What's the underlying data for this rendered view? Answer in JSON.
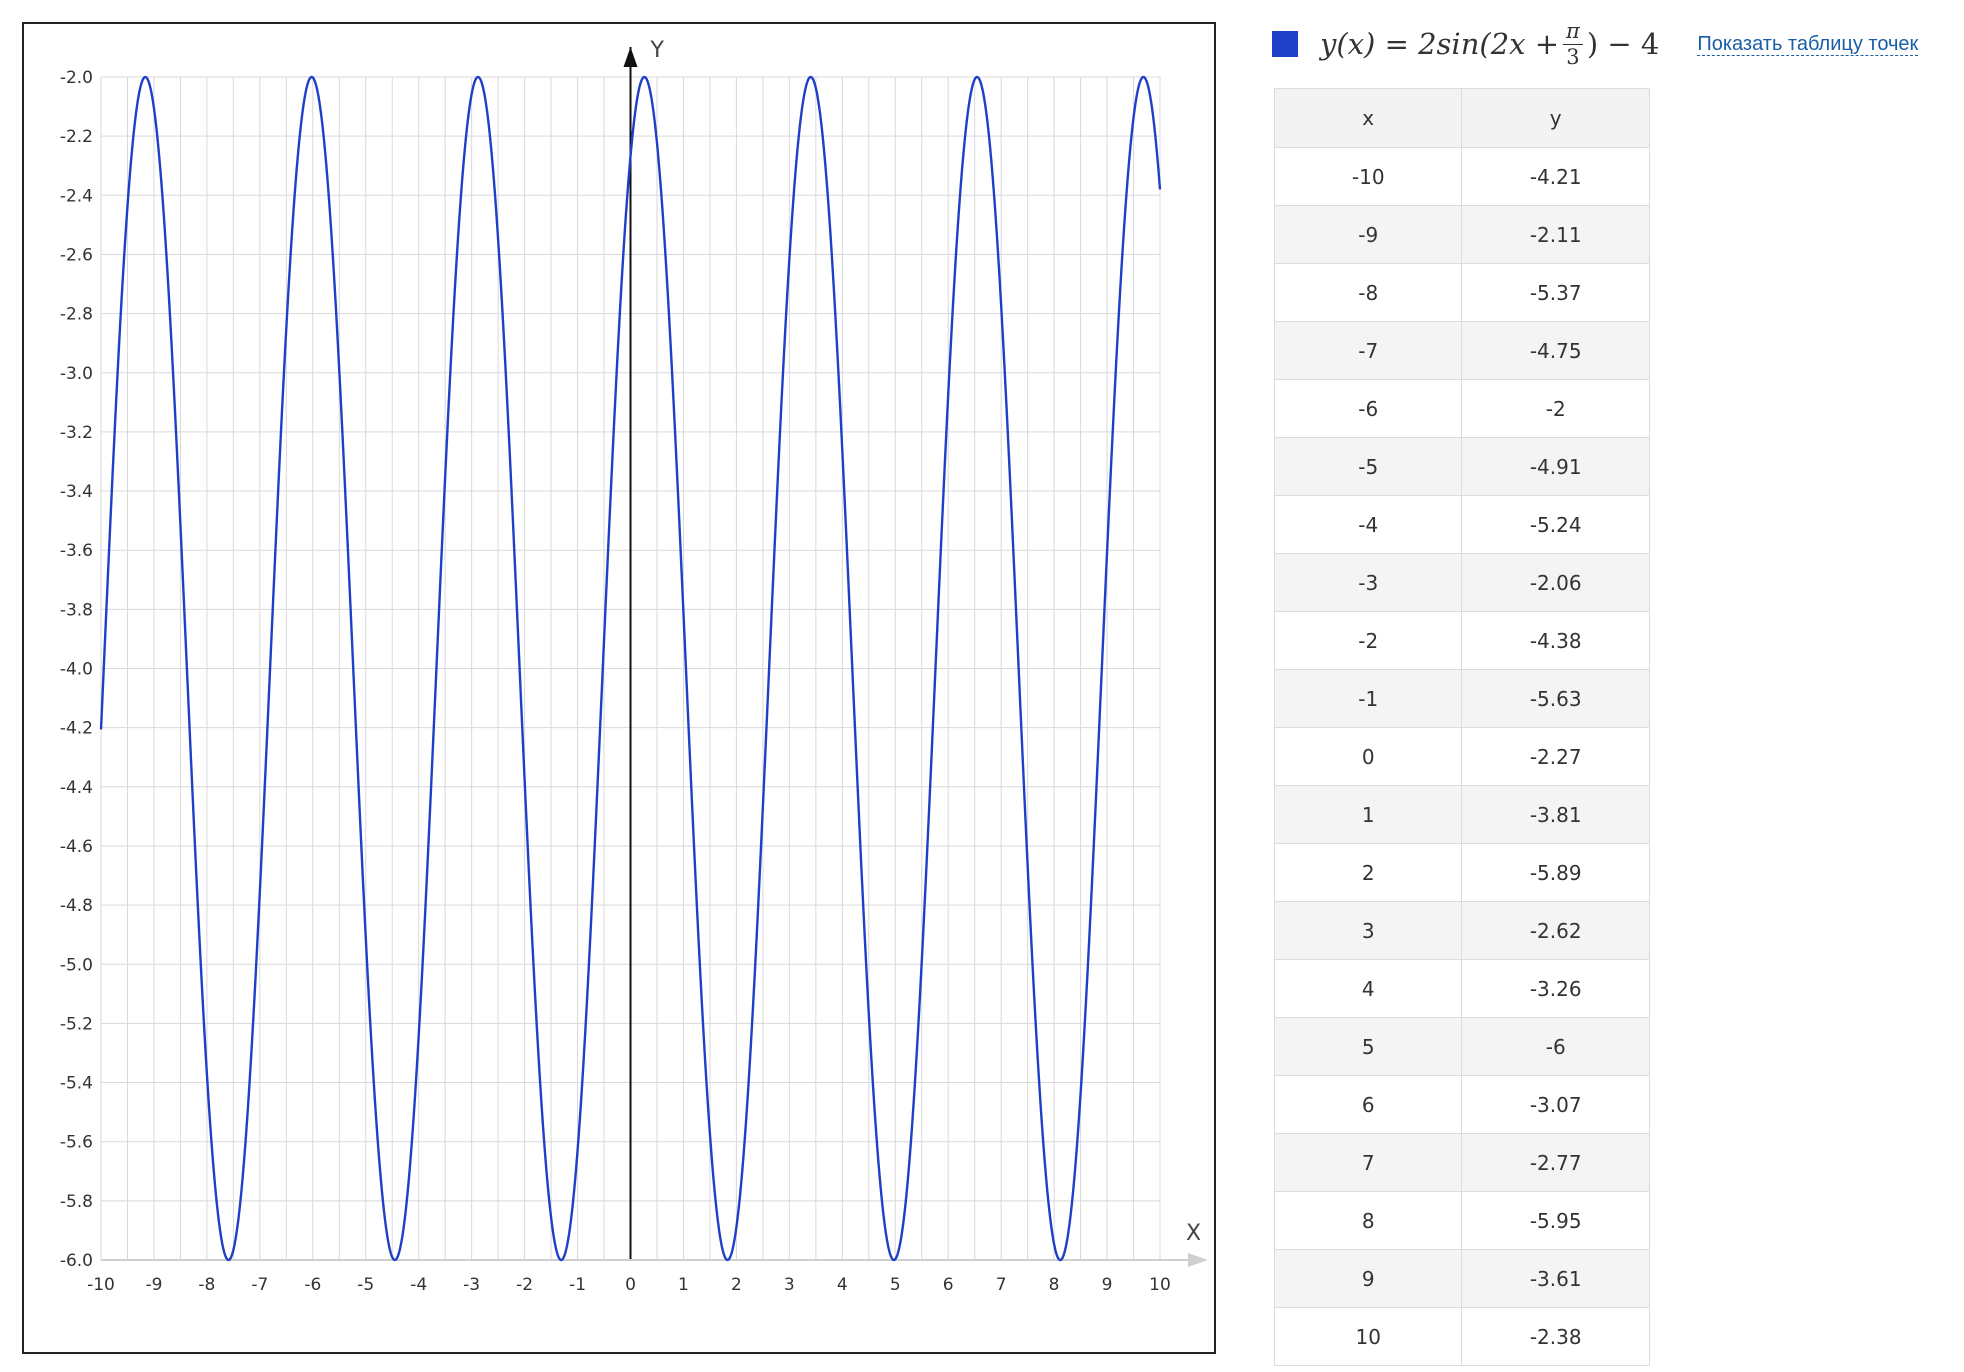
{
  "chart_data": {
    "type": "line",
    "xlabel": "X",
    "ylabel": "Y",
    "xlim": [
      -10,
      10
    ],
    "ylim": [
      -6.0,
      -2.0
    ],
    "grid": true,
    "x_ticks": [
      -10,
      -9,
      -8,
      -7,
      -6,
      -5,
      -4,
      -3,
      -2,
      -1,
      0,
      1,
      2,
      3,
      4,
      5,
      6,
      7,
      8,
      9,
      10
    ],
    "y_ticks": [
      "-2.0",
      "-2.2",
      "-2.4",
      "-2.6",
      "-2.8",
      "-3.0",
      "-3.2",
      "-3.4",
      "-3.6",
      "-3.8",
      "-4.0",
      "-4.2",
      "-4.4",
      "-4.6",
      "-4.8",
      "-5.0",
      "-5.2",
      "-5.4",
      "-5.6",
      "-5.8",
      "-6.0"
    ],
    "series": [
      {
        "color": "#1f3fc7",
        "x": [
          -10,
          -9,
          -8,
          -7,
          -6,
          -5,
          -4,
          -3,
          -2,
          -1,
          0,
          1,
          2,
          3,
          4,
          5,
          6,
          7,
          8,
          9,
          10
        ],
        "y": [
          -4.21,
          -2.11,
          -5.37,
          -4.75,
          -2,
          -4.91,
          -5.24,
          -2.06,
          -4.38,
          -5.63,
          -2.27,
          -3.81,
          -5.89,
          -2.62,
          -3.26,
          -6,
          -3.07,
          -2.77,
          -5.95,
          -3.61,
          -2.38
        ]
      }
    ]
  },
  "legend": {
    "swatch_color": "#1f3fc7",
    "formula_left": "y(x) = 2sin(2x + ",
    "formula_num": "π",
    "formula_den": "3",
    "formula_right": ") − 4",
    "link": "Показать таблицу точек"
  },
  "table": {
    "headers": [
      "x",
      "y"
    ],
    "rows": [
      [
        "-10",
        "-4.21"
      ],
      [
        "-9",
        "-2.11"
      ],
      [
        "-8",
        "-5.37"
      ],
      [
        "-7",
        "-4.75"
      ],
      [
        "-6",
        "-2"
      ],
      [
        "-5",
        "-4.91"
      ],
      [
        "-4",
        "-5.24"
      ],
      [
        "-3",
        "-2.06"
      ],
      [
        "-2",
        "-4.38"
      ],
      [
        "-1",
        "-5.63"
      ],
      [
        "0",
        "-2.27"
      ],
      [
        "1",
        "-3.81"
      ],
      [
        "2",
        "-5.89"
      ],
      [
        "3",
        "-2.62"
      ],
      [
        "4",
        "-3.26"
      ],
      [
        "5",
        "-6"
      ],
      [
        "6",
        "-3.07"
      ],
      [
        "7",
        "-2.77"
      ],
      [
        "8",
        "-5.95"
      ],
      [
        "9",
        "-3.61"
      ],
      [
        "10",
        "-2.38"
      ]
    ]
  }
}
